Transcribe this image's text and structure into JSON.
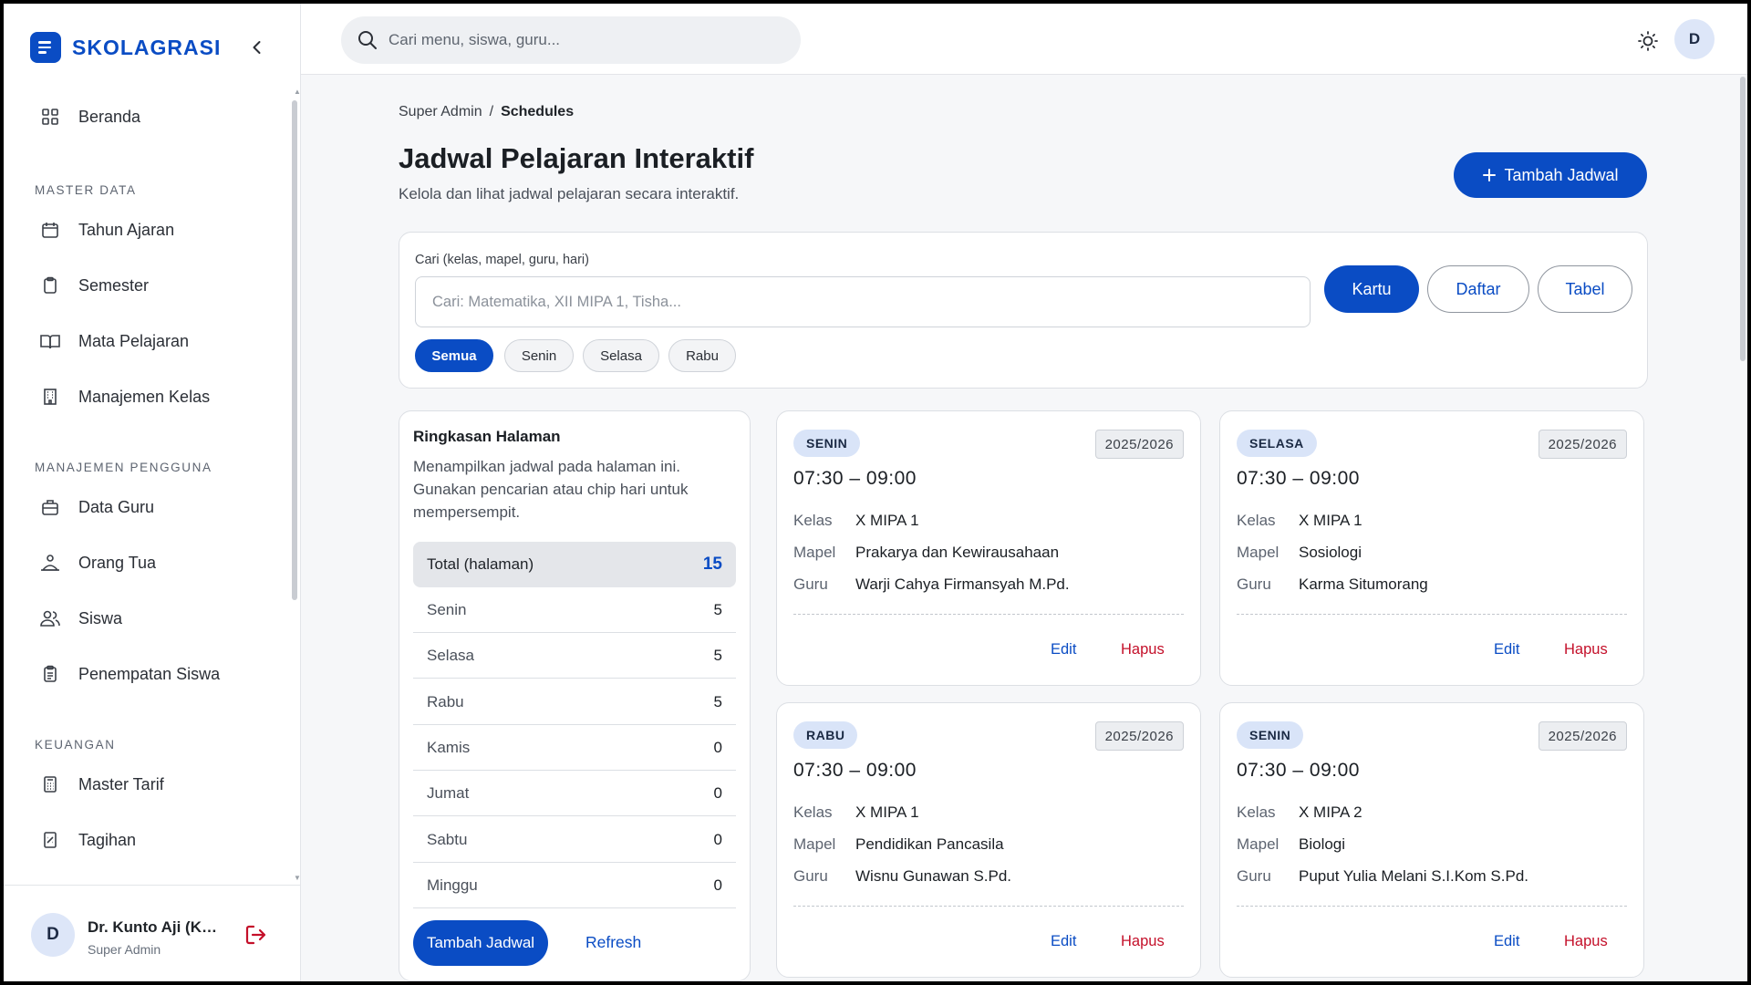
{
  "brand": {
    "name": "SKOLAGRASI"
  },
  "sidebar": {
    "items": [
      {
        "label": "Beranda",
        "icon": "grid-icon"
      },
      {
        "label": "Tahun Ajaran",
        "icon": "calendar-icon"
      },
      {
        "label": "Semester",
        "icon": "clipboard-icon"
      },
      {
        "label": "Mata Pelajaran",
        "icon": "book-icon"
      },
      {
        "label": "Manajemen Kelas",
        "icon": "building-icon"
      },
      {
        "label": "Data Guru",
        "icon": "briefcase-icon"
      },
      {
        "label": "Orang Tua",
        "icon": "parent-icon"
      },
      {
        "label": "Siswa",
        "icon": "users-icon"
      },
      {
        "label": "Penempatan Siswa",
        "icon": "clipboard-list-icon"
      },
      {
        "label": "Master Tarif",
        "icon": "calculator-icon"
      },
      {
        "label": "Tagihan",
        "icon": "receipt-icon"
      }
    ],
    "sections": {
      "master": "MASTER DATA",
      "users": "MANAJEMEN PENGGUNA",
      "finance": "KEUANGAN"
    }
  },
  "user": {
    "initial": "D",
    "name": "Dr. Kunto Aji (Kepala Sekolah)",
    "role": "Super Admin"
  },
  "topbar": {
    "search_placeholder": "Cari menu, siswa, guru...",
    "avatar_initial": "D"
  },
  "breadcrumb": {
    "parent": "Super Admin",
    "separator": "/",
    "current": "Schedules"
  },
  "page": {
    "title": "Jadwal Pelajaran Interaktif",
    "subtitle": "Kelola dan lihat jadwal pelajaran secara interaktif.",
    "add_button": "Tambah Jadwal"
  },
  "filter": {
    "label": "Cari (kelas, mapel, guru, hari)",
    "placeholder": "Cari: Matematika, XII MIPA 1, Tisha...",
    "views": [
      "Kartu",
      "Daftar",
      "Tabel"
    ],
    "active_view": "Kartu",
    "chips": [
      "Semua",
      "Senin",
      "Selasa",
      "Rabu"
    ],
    "active_chip": "Semua"
  },
  "summary": {
    "title": "Ringkasan Halaman",
    "description": "Menampilkan jadwal pada halaman ini. Gunakan pencarian atau chip hari untuk mempersempit.",
    "total_label": "Total (halaman)",
    "total_value": "15",
    "rows": [
      {
        "day": "Senin",
        "count": "5"
      },
      {
        "day": "Selasa",
        "count": "5"
      },
      {
        "day": "Rabu",
        "count": "5"
      },
      {
        "day": "Kamis",
        "count": "0"
      },
      {
        "day": "Jumat",
        "count": "0"
      },
      {
        "day": "Sabtu",
        "count": "0"
      },
      {
        "day": "Minggu",
        "count": "0"
      }
    ],
    "add_button": "Tambah Jadwal",
    "refresh": "Refresh"
  },
  "field_labels": {
    "kelas": "Kelas",
    "mapel": "Mapel",
    "guru": "Guru"
  },
  "card_actions": {
    "edit": "Edit",
    "delete": "Hapus"
  },
  "cards": [
    {
      "day": "SENIN",
      "year": "2025/2026",
      "time": "07:30 – 09:00",
      "kelas": "X MIPA 1",
      "mapel": "Prakarya dan Kewirausahaan",
      "guru": "Warji Cahya Firmansyah M.Pd."
    },
    {
      "day": "SELASA",
      "year": "2025/2026",
      "time": "07:30 – 09:00",
      "kelas": "X MIPA 1",
      "mapel": "Sosiologi",
      "guru": "Karma Situmorang"
    },
    {
      "day": "RABU",
      "year": "2025/2026",
      "time": "07:30 – 09:00",
      "kelas": "X MIPA 1",
      "mapel": "Pendidikan Pancasila",
      "guru": "Wisnu Gunawan S.Pd."
    },
    {
      "day": "SENIN",
      "year": "2025/2026",
      "time": "07:30 – 09:00",
      "kelas": "X MIPA 2",
      "mapel": "Biologi",
      "guru": "Puput Yulia Melani S.I.Kom S.Pd."
    }
  ],
  "colors": {
    "primary": "#0a4cc4",
    "danger": "#c4102a",
    "badge_bg": "#d9e4f8"
  }
}
